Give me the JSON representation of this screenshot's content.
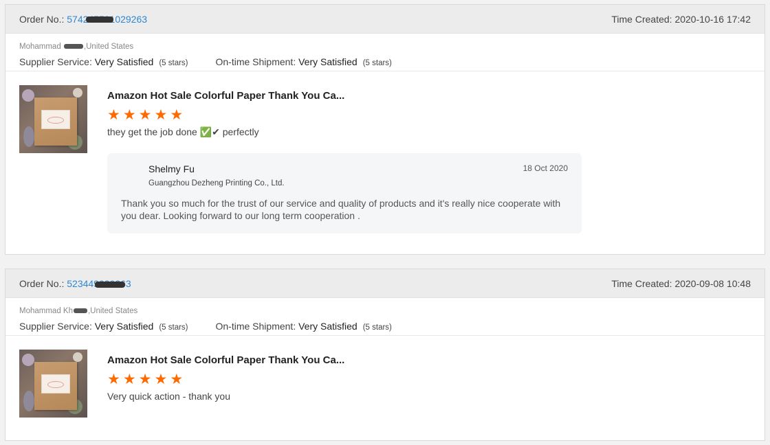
{
  "orders": [
    {
      "order_label": "Order No.:",
      "order_number": "574245501029263",
      "time_label": "Time Created:",
      "time_value": "2020-10-16 17:42",
      "buyer_first": "Mohammad",
      "buyer_country": ",United States",
      "supplier_label": "Supplier Service:",
      "supplier_value": "Very Satisfied",
      "supplier_stars": "(5 stars)",
      "shipment_label": "On-time Shipment:",
      "shipment_value": "Very Satisfied",
      "shipment_stars": "(5 stars)",
      "product_title": "Amazon Hot Sale Colorful Paper Thank You Ca...",
      "rating": 5,
      "review_text": "they get the job done ✅✔ perfectly",
      "reply": {
        "name": "Shelmy Fu",
        "company": "Guangzhou Dezheng Printing Co., Ltd.",
        "date": "18 Oct 2020",
        "text": "Thank you so much for the trust of our service and quality of products and it's really nice cooperate with you dear. Looking forward to our long term cooperation ."
      }
    },
    {
      "order_label": "Order No.:",
      "order_number": "523449029263",
      "time_label": "Time Created:",
      "time_value": "2020-09-08 10:48",
      "buyer_first": "Mohammad Kh",
      "buyer_country": ",United States",
      "supplier_label": "Supplier Service:",
      "supplier_value": "Very Satisfied",
      "supplier_stars": "(5 stars)",
      "shipment_label": "On-time Shipment:",
      "shipment_value": "Very Satisfied",
      "shipment_stars": "(5 stars)",
      "product_title": "Amazon Hot Sale Colorful Paper Thank You Ca...",
      "rating": 5,
      "review_text": "Very quick action - thank you"
    }
  ],
  "colors": {
    "star": "#ff6a00",
    "link": "#2f86d2",
    "header_bg": "#ececec"
  },
  "icons": {
    "star": "star-icon"
  }
}
